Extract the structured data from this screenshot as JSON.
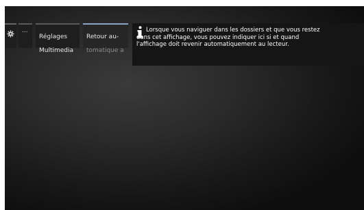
{
  "breadcrumb": {
    "more_label": "...",
    "multimedia": {
      "line1": "Réglages",
      "line2": "Multimedia"
    },
    "active": {
      "line1": "Retour au-",
      "line2": "tomatique a"
    }
  },
  "info": {
    "text": "Lorsque vous naviguer dans les dossiers et que vous restez dans cet affichage, vous pouvez indiquer ici si et quand l'affichage doit revenir automatiquement au lecteur."
  },
  "icons": {
    "gear": "gear-icon",
    "info": "info-icon"
  },
  "colors": {
    "active_accent": "#8aa3c0",
    "panel_bg": "#151515"
  }
}
